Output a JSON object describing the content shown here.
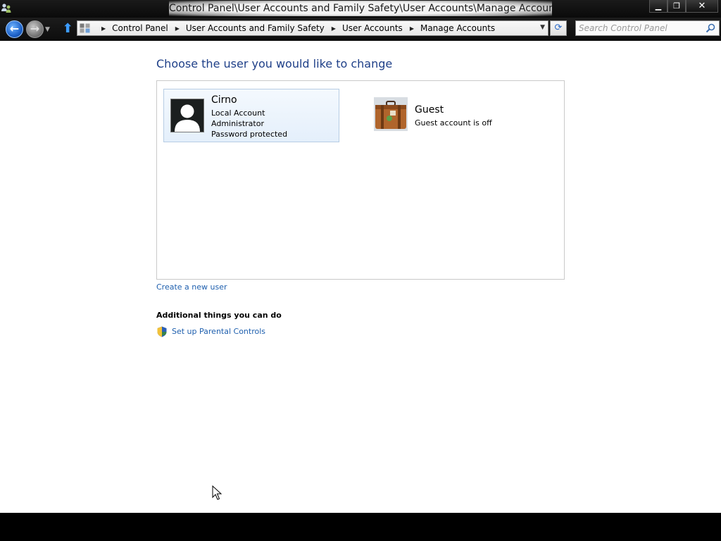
{
  "window": {
    "title": "Control Panel\\User Accounts and Family Safety\\User Accounts\\Manage Accounts"
  },
  "nav": {
    "breadcrumbs": [
      "Control Panel",
      "User Accounts and Family Safety",
      "User Accounts",
      "Manage Accounts"
    ],
    "search_placeholder": "Search Control Panel"
  },
  "page": {
    "heading": "Choose the user you would like to change",
    "users": [
      {
        "name": "Cirno",
        "details": [
          "Local Account",
          "Administrator",
          "Password protected"
        ],
        "selected": true,
        "avatar": "person-silhouette-icon"
      },
      {
        "name": "Guest",
        "details": [
          "Guest account is off"
        ],
        "selected": false,
        "avatar": "suitcase-icon"
      }
    ],
    "create_user_link": "Create a new user",
    "additional_heading": "Additional things you can do",
    "parental_controls_link": "Set up Parental Controls"
  },
  "colors": {
    "heading": "#1e3f88",
    "link": "#1e5fae",
    "selected_tile": "#e4effb"
  }
}
